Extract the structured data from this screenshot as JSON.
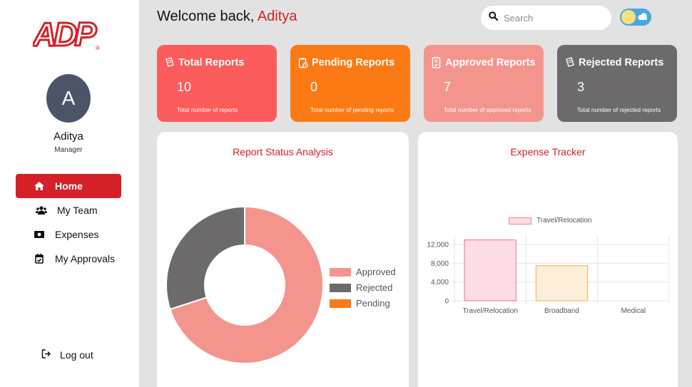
{
  "brand": {
    "logo_text": "ADP",
    "accent_color": "#d42027"
  },
  "user": {
    "initial": "A",
    "name": "Aditya",
    "role": "Manager"
  },
  "sidebar": {
    "items": [
      {
        "label": "Home",
        "icon": "home-icon",
        "active": true
      },
      {
        "label": "My Team",
        "icon": "team-icon",
        "active": false
      },
      {
        "label": "Expenses",
        "icon": "money-icon",
        "active": false
      },
      {
        "label": "My Approvals",
        "icon": "calendar-check-icon",
        "active": false
      }
    ],
    "logout_label": "Log out"
  },
  "header": {
    "welcome_prefix": "Welcome back,",
    "welcome_name": "Aditya",
    "search_placeholder": "Search"
  },
  "cards": [
    {
      "title": "Total Reports",
      "count": "10",
      "desc": "Total number of reports",
      "color": "#fd5c5c",
      "icon": "receipt-icon"
    },
    {
      "title": "Pending Reports",
      "count": "0",
      "desc": "Total number of pending reports",
      "color": "#fc7a14",
      "icon": "clipboard-clock-icon"
    },
    {
      "title": "Approved Reports",
      "count": "7",
      "desc": "Total number of approved reports",
      "color": "#f4958d",
      "icon": "document-check-icon"
    },
    {
      "title": "Rejected Reports",
      "count": "3",
      "desc": "Total number of rejected reports",
      "color": "#6c6a6a",
      "icon": "receipt-icon"
    }
  ],
  "status_chart": {
    "title": "Report Status Analysis",
    "chart_data": {
      "type": "pie",
      "labels": [
        "Approved",
        "Rejected",
        "Pending"
      ],
      "values": [
        7,
        3,
        0
      ],
      "colors": [
        "#f4958d",
        "#6c6a6a",
        "#fc7a14"
      ],
      "donut": true,
      "legend": "right"
    }
  },
  "expense_chart": {
    "title": "Expense Tracker",
    "chart_data": {
      "type": "bar",
      "categories": [
        "Travel/Relocation",
        "Broadband",
        "Medical"
      ],
      "series": [
        {
          "name": "Travel/Relocation",
          "values": [
            13000,
            7500,
            0
          ]
        }
      ],
      "bar_fill_colors": [
        "#ffdde4",
        "#fdeed9",
        "#e0eaf7"
      ],
      "bar_border_colors": [
        "#f3849b",
        "#f4b76a",
        "#8fb4e6"
      ],
      "ylim": [
        0,
        14000
      ],
      "yticks": [
        "0",
        "4,000",
        "8,000",
        "12,000"
      ],
      "ytick_values": [
        0,
        4000,
        8000,
        12000
      ],
      "grid": true,
      "legend": "top"
    }
  }
}
